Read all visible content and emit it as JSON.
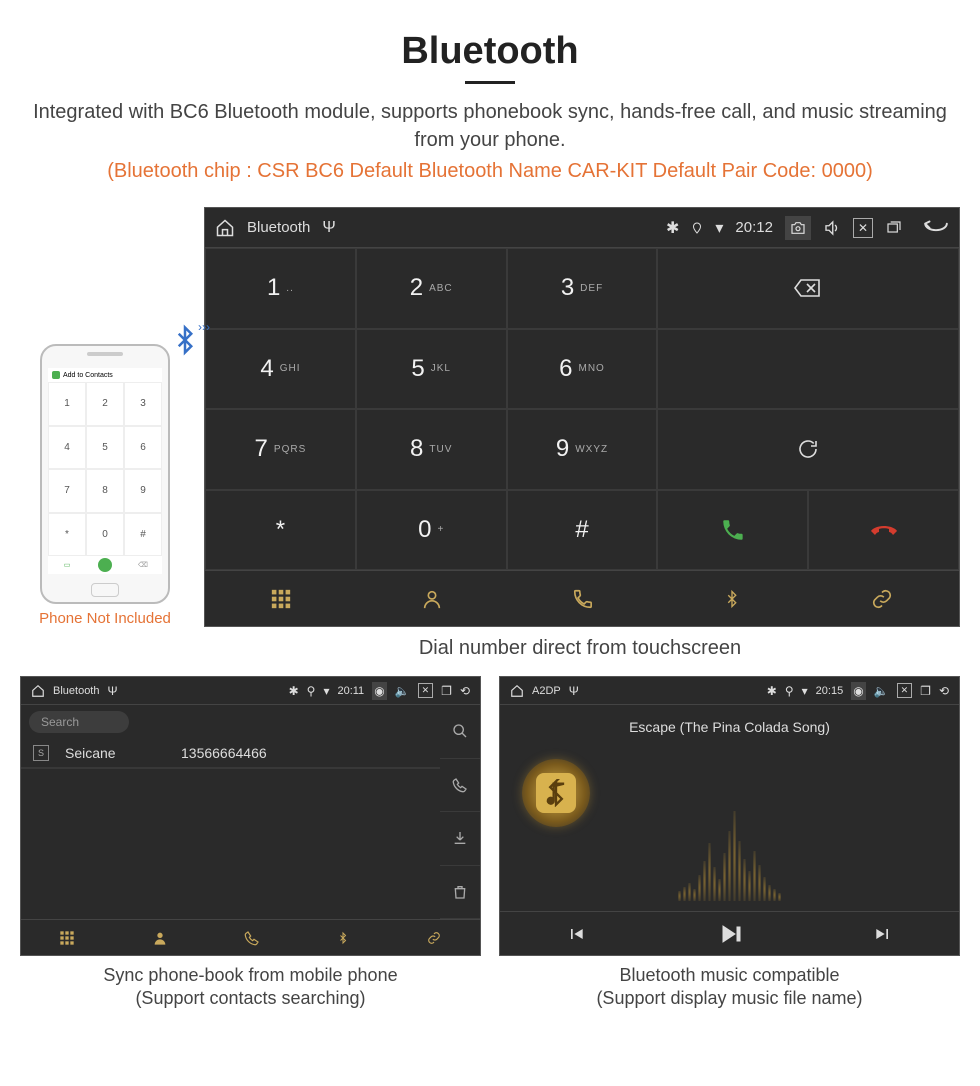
{
  "title": "Bluetooth",
  "subtitle": "Integrated with BC6 Bluetooth module, supports phonebook sync, hands-free call, and music streaming from your phone.",
  "chipinfo": "(Bluetooth chip : CSR BC6     Default Bluetooth Name CAR-KIT     Default Pair Code: 0000)",
  "phone_caption": "Phone Not Included",
  "phone_header": "Add to Contacts",
  "main": {
    "statusbar": {
      "app": "Bluetooth",
      "time": "20:12"
    },
    "keys": [
      {
        "d": "1",
        "l": ".."
      },
      {
        "d": "2",
        "l": "ABC"
      },
      {
        "d": "3",
        "l": "DEF"
      },
      {
        "d": "4",
        "l": "GHI"
      },
      {
        "d": "5",
        "l": "JKL"
      },
      {
        "d": "6",
        "l": "MNO"
      },
      {
        "d": "7",
        "l": "PQRS"
      },
      {
        "d": "8",
        "l": "TUV"
      },
      {
        "d": "9",
        "l": "WXYZ"
      },
      {
        "d": "*",
        "l": ""
      },
      {
        "d": "0",
        "l": "+"
      },
      {
        "d": "#",
        "l": ""
      }
    ],
    "caption": "Dial number direct from touchscreen"
  },
  "contacts": {
    "statusbar": {
      "app": "Bluetooth",
      "time": "20:11"
    },
    "search_placeholder": "Search",
    "rows": [
      {
        "badge": "S",
        "name": "Seicane",
        "number": "13566664466"
      }
    ],
    "caption1": "Sync phone-book from mobile phone",
    "caption2": "(Support contacts searching)"
  },
  "music": {
    "statusbar": {
      "app": "A2DP",
      "time": "20:15"
    },
    "track": "Escape (The Pina Colada Song)",
    "caption1": "Bluetooth music compatible",
    "caption2": "(Support display music file name)"
  }
}
